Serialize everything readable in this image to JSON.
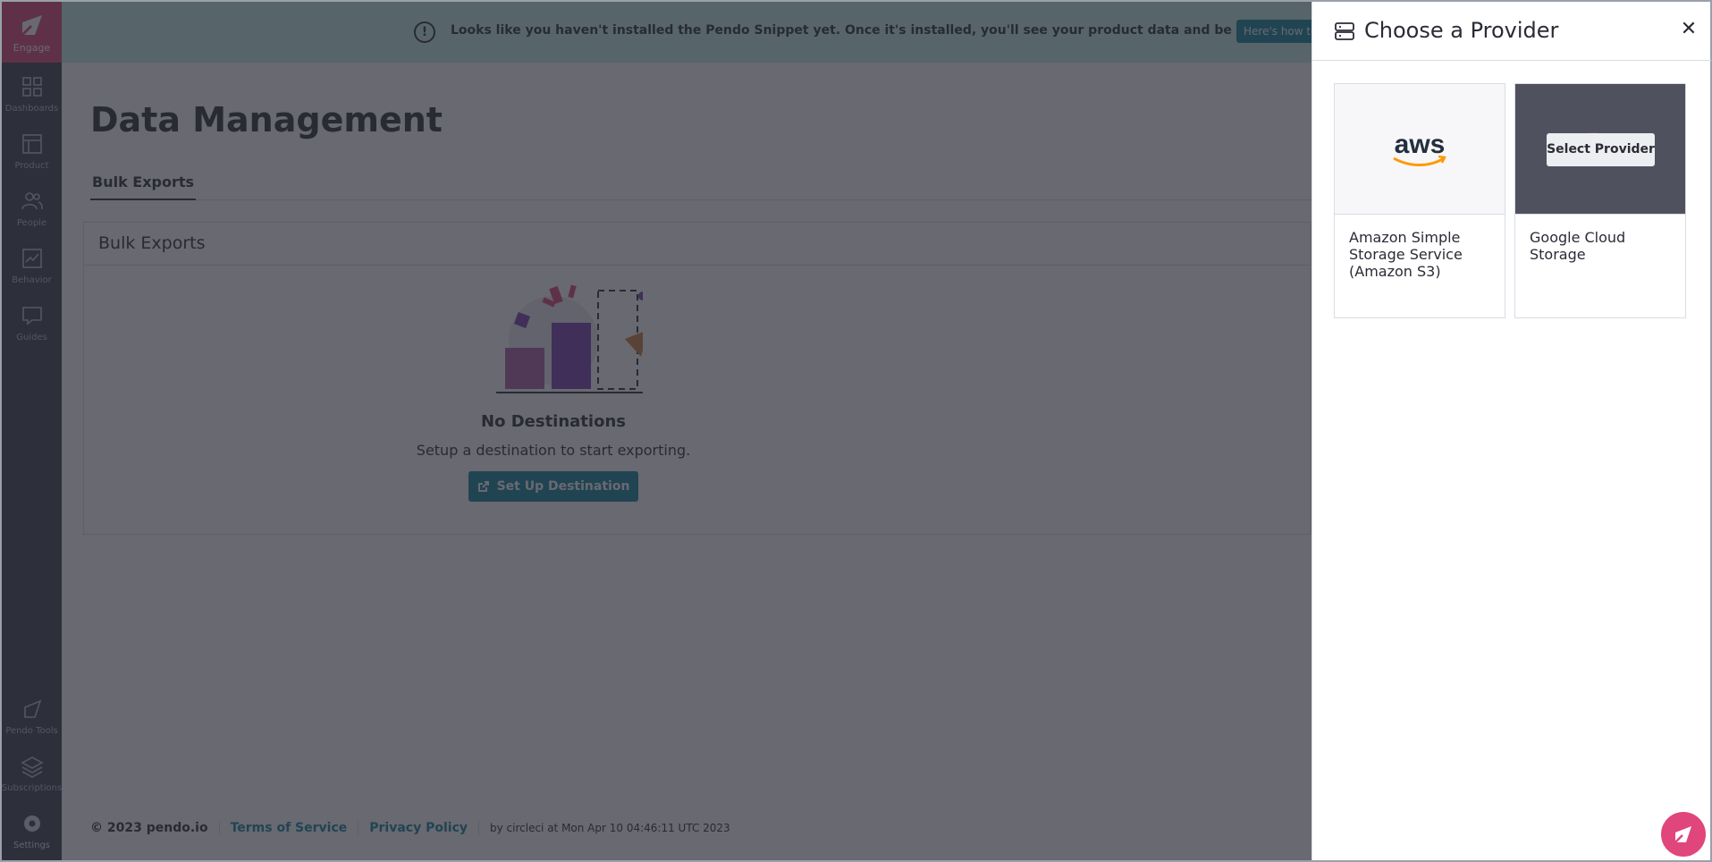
{
  "sidebar": {
    "logo_label": "Engage",
    "items": [
      {
        "label": "Dashboards"
      },
      {
        "label": "Product"
      },
      {
        "label": "People"
      },
      {
        "label": "Behavior"
      },
      {
        "label": "Guides"
      }
    ],
    "bottom_items": [
      {
        "label": "Pendo Tools"
      },
      {
        "label": "Subscriptions"
      },
      {
        "label": "Settings"
      }
    ]
  },
  "banner": {
    "message": "Looks like you haven't installed the Pendo Snippet yet. Once it's installed, you'll see your product data and be able to use Pendo.",
    "button_label": "Here's how to"
  },
  "page": {
    "title": "Data Management",
    "tabs": [
      {
        "label": "Bulk Exports"
      }
    ]
  },
  "card": {
    "header": "Bulk Exports",
    "empty_title": "No Destinations",
    "empty_subtitle": "Setup a destination to start exporting.",
    "button_label": "Set Up Destination"
  },
  "footer": {
    "copyright": "© 2023 pendo.io",
    "terms": "Terms of Service",
    "privacy": "Privacy Policy",
    "build": "by circleci at Mon Apr 10 04:46:11 UTC 2023"
  },
  "drawer": {
    "title": "Choose a Provider",
    "close_icon": "close-icon",
    "providers": [
      {
        "name": "Amazon Simple Storage Service (Amazon S3)",
        "logo": "aws"
      },
      {
        "name": "Google Cloud Storage",
        "logo": "google-cloud-icon",
        "hover_label": "Select Provider"
      }
    ]
  },
  "colors": {
    "brand_pink": "#e0457b",
    "teal": "#128297",
    "sidebar": "#3a3d4a",
    "banner": "#c6f0ec"
  }
}
